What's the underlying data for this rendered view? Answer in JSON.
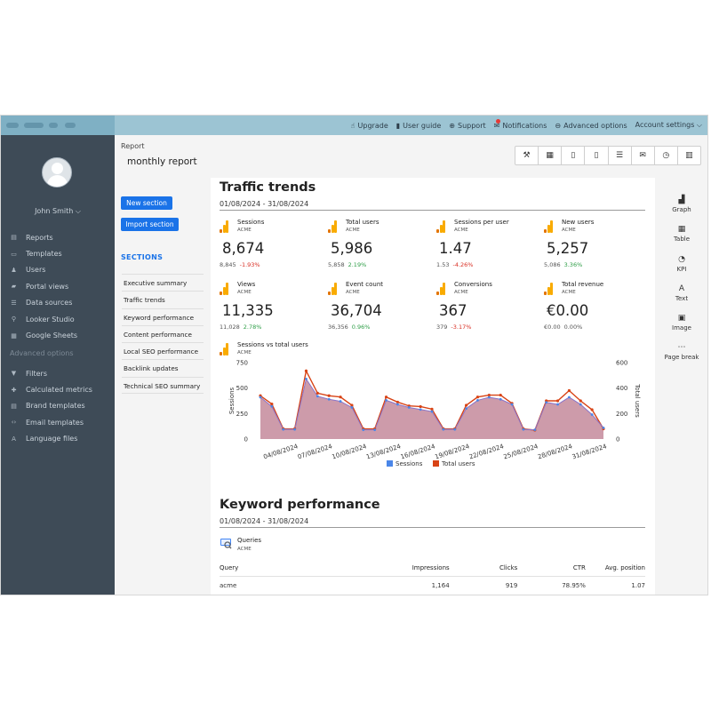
{
  "topnav": {
    "items": [
      {
        "icon": "thumbs-up-icon",
        "glyph": "☝",
        "label": "Upgrade"
      },
      {
        "icon": "book-icon",
        "glyph": "▮",
        "label": "User guide"
      },
      {
        "icon": "lifebuoy-icon",
        "glyph": "⊕",
        "label": "Support"
      },
      {
        "icon": "megaphone-icon",
        "glyph": "✉",
        "label": "Notifications"
      },
      {
        "icon": "minus-circle-icon",
        "glyph": "⊖",
        "label": "Advanced options"
      },
      {
        "icon": "",
        "glyph": "",
        "label": "Account settings ⌵"
      }
    ]
  },
  "sidebar": {
    "username": "John Smith ⌵",
    "main_items": [
      {
        "icon": "reports-icon",
        "glyph": "▤",
        "label": "Reports"
      },
      {
        "icon": "templates-icon",
        "glyph": "▭",
        "label": "Templates"
      },
      {
        "icon": "users-icon",
        "glyph": "♟",
        "label": "Users"
      },
      {
        "icon": "folder-icon",
        "glyph": "▰",
        "label": "Portal views"
      },
      {
        "icon": "database-icon",
        "glyph": "☰",
        "label": "Data sources"
      },
      {
        "icon": "looker-icon",
        "glyph": "⚲",
        "label": "Looker Studio"
      },
      {
        "icon": "sheets-icon",
        "glyph": "▦",
        "label": "Google Sheets"
      }
    ],
    "advanced_label": "Advanced options",
    "advanced_items": [
      {
        "icon": "filter-icon",
        "glyph": "▼",
        "label": "Filters"
      },
      {
        "icon": "plus-icon",
        "glyph": "✚",
        "label": "Calculated metrics"
      },
      {
        "icon": "brand-icon",
        "glyph": "▤",
        "label": "Brand templates"
      },
      {
        "icon": "code-icon",
        "glyph": "‹›",
        "label": "Email templates"
      },
      {
        "icon": "language-icon",
        "glyph": "A",
        "label": "Language files"
      }
    ]
  },
  "report": {
    "label": "Report",
    "name": "monthly report",
    "new_section": "New section",
    "import_section": "Import section",
    "sections_title": "SECTIONS",
    "sections": [
      "Executive summary",
      "Traffic trends",
      "Keyword performance",
      "Content performance",
      "Local SEO performance",
      "Backlink updates",
      "Technical SEO summary"
    ]
  },
  "toolbar": [
    {
      "icon": "wrench-icon",
      "glyph": "⚒"
    },
    {
      "icon": "calendar-icon",
      "glyph": "▦"
    },
    {
      "icon": "pdf-icon",
      "glyph": "▯"
    },
    {
      "icon": "excel-icon",
      "glyph": "▯"
    },
    {
      "icon": "stack-icon",
      "glyph": "☰"
    },
    {
      "icon": "email-icon",
      "glyph": "✉"
    },
    {
      "icon": "clock-icon",
      "glyph": "◷"
    },
    {
      "icon": "trash-icon",
      "glyph": "▥"
    }
  ],
  "traffic": {
    "title": "Traffic trends",
    "date_range": "01/08/2024 - 31/08/2024",
    "kpis": [
      {
        "label": "Sessions",
        "source": "ACME",
        "value": "8,674",
        "prev": "8,845",
        "change": "-1.93%",
        "dir": "down"
      },
      {
        "label": "Total users",
        "source": "ACME",
        "value": "5,986",
        "prev": "5,858",
        "change": "2.19%",
        "dir": "up"
      },
      {
        "label": "Sessions per user",
        "source": "ACME",
        "value": "1.47",
        "prev": "1.53",
        "change": "-4.26%",
        "dir": "down"
      },
      {
        "label": "New users",
        "source": "ACME",
        "value": "5,257",
        "prev": "5,086",
        "change": "3.36%",
        "dir": "up"
      },
      {
        "label": "Views",
        "source": "ACME",
        "value": "11,335",
        "prev": "11,028",
        "change": "2.78%",
        "dir": "up"
      },
      {
        "label": "Event count",
        "source": "ACME",
        "value": "36,704",
        "prev": "36,356",
        "change": "0.96%",
        "dir": "up"
      },
      {
        "label": "Conversions",
        "source": "ACME",
        "value": "367",
        "prev": "379",
        "change": "-3.17%",
        "dir": "down"
      },
      {
        "label": "Total revenue",
        "source": "ACME",
        "value": "€0.00",
        "prev": "€0.00",
        "change": "0.00%",
        "dir": "flat"
      }
    ]
  },
  "chart_data": {
    "type": "area",
    "title": "Sessions vs total users",
    "source": "ACME",
    "xlabel": "",
    "ylabel": "Sessions",
    "y2label": "Total users",
    "ylim": [
      0,
      750
    ],
    "y2lim": [
      0,
      600
    ],
    "yticks": [
      0,
      250,
      500,
      750
    ],
    "y2ticks": [
      0,
      200,
      400,
      600
    ],
    "xtick_labels": [
      "04/08/2024",
      "07/08/2024",
      "10/08/2024",
      "13/08/2024",
      "16/08/2024",
      "19/08/2024",
      "22/08/2024",
      "25/08/2024",
      "28/08/2024",
      "31/08/2024"
    ],
    "x": [
      "01/08",
      "02/08",
      "03/08",
      "04/08",
      "05/08",
      "06/08",
      "07/08",
      "08/08",
      "09/08",
      "10/08",
      "11/08",
      "12/08",
      "13/08",
      "14/08",
      "15/08",
      "16/08",
      "17/08",
      "18/08",
      "19/08",
      "20/08",
      "21/08",
      "22/08",
      "23/08",
      "24/08",
      "25/08",
      "26/08",
      "27/08",
      "28/08",
      "29/08",
      "30/08",
      "31/08"
    ],
    "series": [
      {
        "name": "Sessions",
        "color": "#4a86e8",
        "axis": "left",
        "values": [
          410,
          320,
          95,
          95,
          590,
          420,
          390,
          370,
          310,
          90,
          90,
          380,
          340,
          310,
          290,
          270,
          95,
          95,
          300,
          380,
          410,
          390,
          340,
          95,
          90,
          360,
          340,
          410,
          340,
          240,
          110
        ]
      },
      {
        "name": "Total users",
        "color": "#d84315",
        "axis": "right",
        "values": [
          340,
          275,
          80,
          80,
          535,
          360,
          340,
          330,
          265,
          80,
          80,
          330,
          290,
          260,
          255,
          235,
          80,
          80,
          265,
          330,
          345,
          345,
          280,
          80,
          70,
          300,
          300,
          380,
          300,
          230,
          80
        ]
      }
    ],
    "legend": "bottom",
    "fill_color": "#c4899b"
  },
  "keywords": {
    "title": "Keyword performance",
    "date_range": "01/08/2024 - 31/08/2024",
    "table_title": "Queries",
    "table_source": "ACME",
    "columns": [
      "Query",
      "Impressions",
      "Clicks",
      "CTR",
      "Avg. position"
    ],
    "rows": [
      [
        "acme",
        "1,164",
        "919",
        "78.95%",
        "1.07"
      ]
    ]
  },
  "rightpanel": [
    {
      "icon": "graph-icon",
      "glyph": "▟",
      "label": "Graph"
    },
    {
      "icon": "table-icon",
      "glyph": "▦",
      "label": "Table"
    },
    {
      "icon": "kpi-icon",
      "glyph": "◔",
      "label": "KPI"
    },
    {
      "icon": "text-icon",
      "glyph": "A",
      "label": "Text"
    },
    {
      "icon": "image-icon",
      "glyph": "▣",
      "label": "Image"
    },
    {
      "icon": "page-break-icon",
      "glyph": "⋯",
      "label": "Page break"
    }
  ]
}
